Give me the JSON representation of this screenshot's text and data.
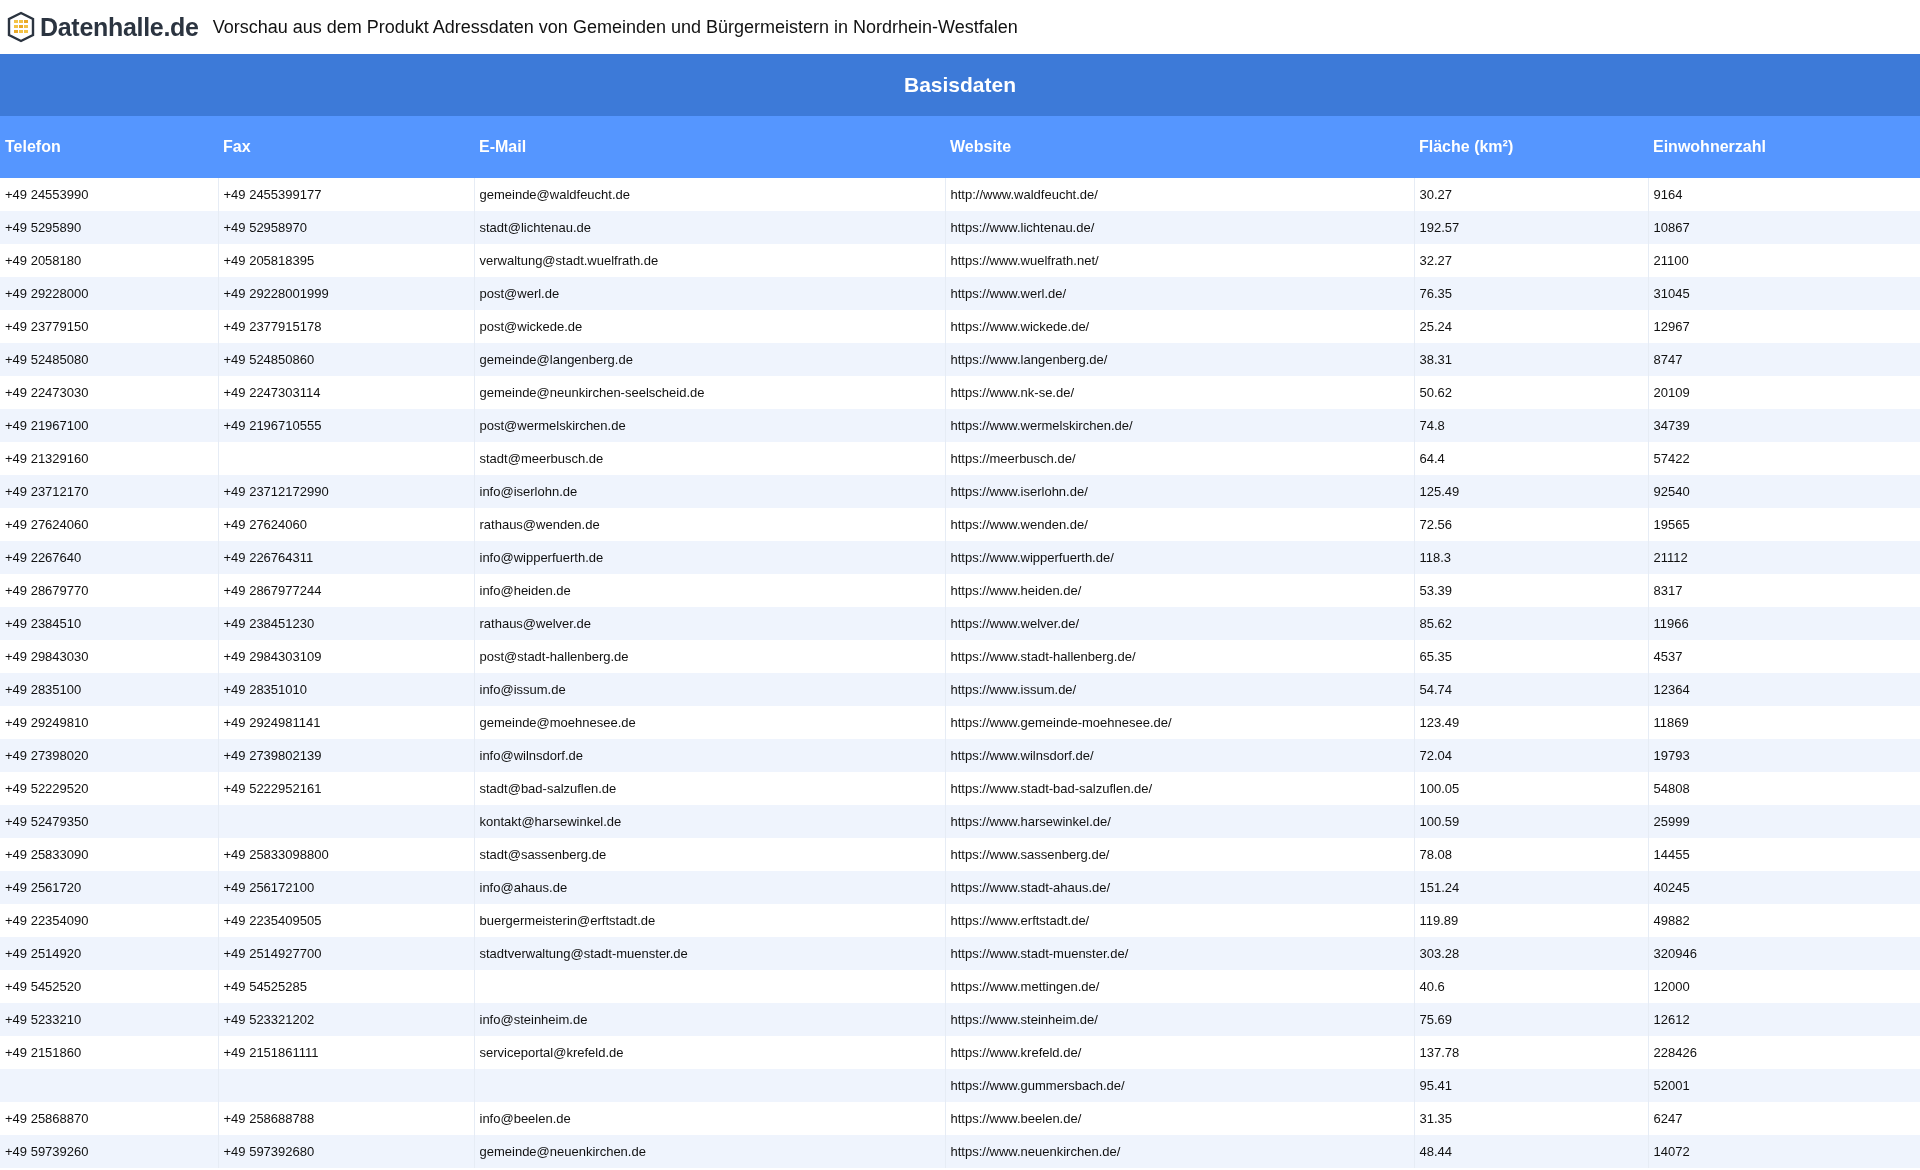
{
  "header": {
    "logo": "Datenhalle.de",
    "title": "Vorschau aus dem Produkt Adressdaten von Gemeinden und Bürgermeistern in Nordrhein-Westfalen"
  },
  "table": {
    "group_heading": "Basisdaten",
    "columns": [
      "Telefon",
      "Fax",
      "E-Mail",
      "Website",
      "Fläche (km²)",
      "Einwohnerzahl"
    ],
    "rows": [
      [
        "+49 24553990",
        "+49 2455399177",
        "gemeinde@waldfeucht.de",
        "http://www.waldfeucht.de/",
        "30.27",
        "9164"
      ],
      [
        "+49 5295890",
        "+49 52958970",
        "stadt@lichtenau.de",
        "https://www.lichtenau.de/",
        "192.57",
        "10867"
      ],
      [
        "+49 2058180",
        "+49 205818395",
        "verwaltung@stadt.wuelfrath.de",
        "https://www.wuelfrath.net/",
        "32.27",
        "21100"
      ],
      [
        "+49 29228000",
        "+49 29228001999",
        "post@werl.de",
        "https://www.werl.de/",
        "76.35",
        "31045"
      ],
      [
        "+49 23779150",
        "+49 2377915178",
        "post@wickede.de",
        "https://www.wickede.de/",
        "25.24",
        "12967"
      ],
      [
        "+49 52485080",
        "+49 524850860",
        "gemeinde@langenberg.de",
        "https://www.langenberg.de/",
        "38.31",
        "8747"
      ],
      [
        "+49 22473030",
        "+49 2247303114",
        "gemeinde@neunkirchen-seelscheid.de",
        "https://www.nk-se.de/",
        "50.62",
        "20109"
      ],
      [
        "+49 21967100",
        "+49 2196710555",
        "post@wermelskirchen.de",
        "https://www.wermelskirchen.de/",
        "74.8",
        "34739"
      ],
      [
        "+49 21329160",
        null,
        "stadt@meerbusch.de",
        "https://meerbusch.de/",
        "64.4",
        "57422"
      ],
      [
        "+49 23712170",
        "+49 23712172990",
        "info@iserlohn.de",
        "https://www.iserlohn.de/",
        "125.49",
        "92540"
      ],
      [
        "+49 27624060",
        "+49 27624060",
        "rathaus@wenden.de",
        "https://www.wenden.de/",
        "72.56",
        "19565"
      ],
      [
        "+49 2267640",
        "+49 226764311",
        "info@wipperfuerth.de",
        "https://www.wipperfuerth.de/",
        "118.3",
        "21112"
      ],
      [
        "+49 28679770",
        "+49 2867977244",
        "info@heiden.de",
        "https://www.heiden.de/",
        "53.39",
        "8317"
      ],
      [
        "+49 2384510",
        "+49 238451230",
        "rathaus@welver.de",
        "https://www.welver.de/",
        "85.62",
        "11966"
      ],
      [
        "+49 29843030",
        "+49 2984303109",
        "post@stadt-hallenberg.de",
        "https://www.stadt-hallenberg.de/",
        "65.35",
        "4537"
      ],
      [
        "+49 2835100",
        "+49 28351010",
        "info@issum.de",
        "https://www.issum.de/",
        "54.74",
        "12364"
      ],
      [
        "+49 29249810",
        "+49 2924981141",
        "gemeinde@moehnesee.de",
        "https://www.gemeinde-moehnesee.de/",
        "123.49",
        "11869"
      ],
      [
        "+49 27398020",
        "+49 2739802139",
        "info@wilnsdorf.de",
        "https://www.wilnsdorf.de/",
        "72.04",
        "19793"
      ],
      [
        "+49 52229520",
        "+49 5222952161",
        "stadt@bad-salzuflen.de",
        "https://www.stadt-bad-salzuflen.de/",
        "100.05",
        "54808"
      ],
      [
        "+49 52479350",
        null,
        "kontakt@harsewinkel.de",
        "https://www.harsewinkel.de/",
        "100.59",
        "25999"
      ],
      [
        "+49 25833090",
        "+49 25833098800",
        "stadt@sassenberg.de",
        "https://www.sassenberg.de/",
        "78.08",
        "14455"
      ],
      [
        "+49 2561720",
        "+49 256172100",
        "info@ahaus.de",
        "https://www.stadt-ahaus.de/",
        "151.24",
        "40245"
      ],
      [
        "+49 22354090",
        "+49 2235409505",
        "buergermeisterin@erftstadt.de",
        "https://www.erftstadt.de/",
        "119.89",
        "49882"
      ],
      [
        "+49 2514920",
        "+49 2514927700",
        "stadtverwaltung@stadt-muenster.de",
        "https://www.stadt-muenster.de/",
        "303.28",
        "320946"
      ],
      [
        "+49 5452520",
        "+49 54525285",
        null,
        "https://www.mettingen.de/",
        "40.6",
        "12000"
      ],
      [
        "+49 5233210",
        "+49 523321202",
        "info@steinheim.de",
        "https://www.steinheim.de/",
        "75.69",
        "12612"
      ],
      [
        "+49 2151860",
        "+49 2151861111",
        "serviceportal@krefeld.de",
        "https://www.krefeld.de/",
        "137.78",
        "228426"
      ],
      [
        null,
        null,
        null,
        "https://www.gummersbach.de/",
        "95.41",
        "52001"
      ],
      [
        "+49 25868870",
        "+49 258688788",
        "info@beelen.de",
        "https://www.beelen.de/",
        "31.35",
        "6247"
      ],
      [
        "+49 59739260",
        "+49 597392680",
        "gemeinde@neuenkirchen.de",
        "https://www.neuenkirchen.de/",
        "48.44",
        "14072"
      ]
    ]
  }
}
